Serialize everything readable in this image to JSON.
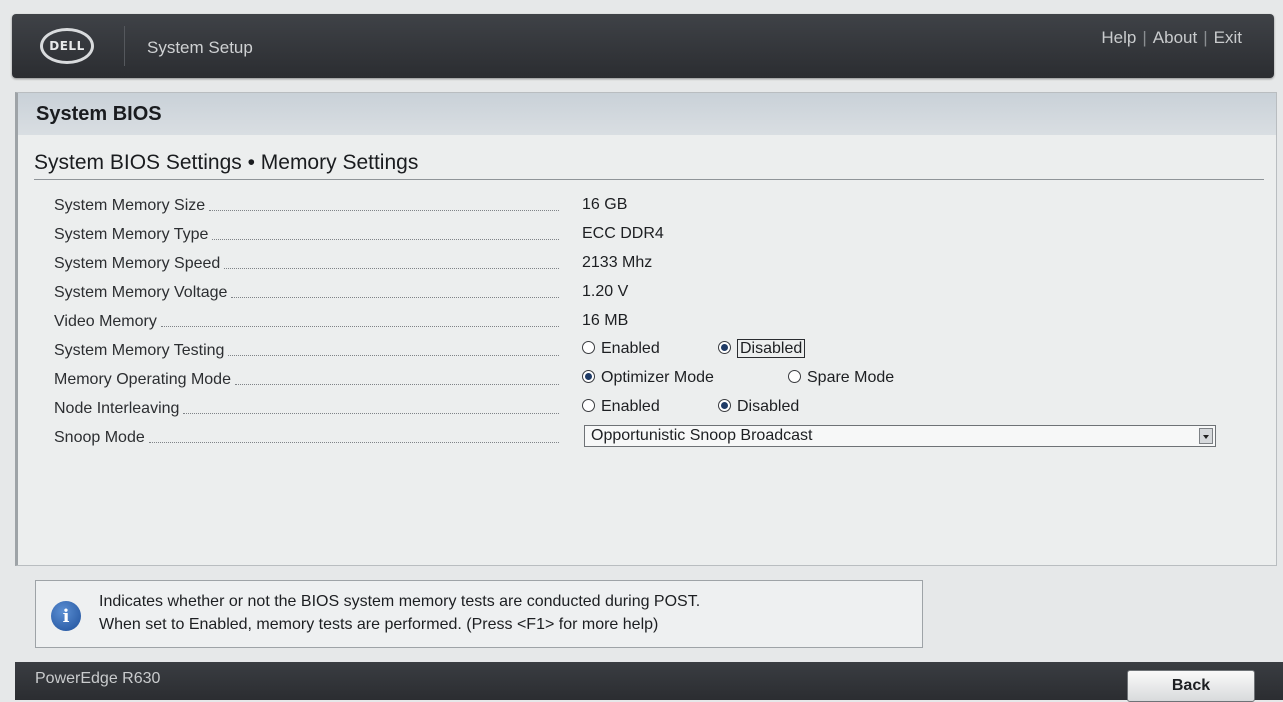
{
  "header": {
    "logo_text": "DELL",
    "title": "System Setup",
    "links": [
      "Help",
      "About",
      "Exit"
    ]
  },
  "panel": {
    "title": "System BIOS",
    "heading": "System BIOS Settings • Memory Settings"
  },
  "settings": [
    {
      "label": "System Memory Size",
      "value": "16 GB"
    },
    {
      "label": "System Memory Type",
      "value": "ECC DDR4"
    },
    {
      "label": "System Memory Speed",
      "value": "2133 Mhz"
    },
    {
      "label": "System Memory Voltage",
      "value": "1.20 V"
    },
    {
      "label": "Video Memory",
      "value": "16 MB"
    },
    {
      "label": "System Memory Testing",
      "options": [
        "Enabled",
        "Disabled"
      ],
      "selected": "Disabled"
    },
    {
      "label": "Memory Operating Mode",
      "options": [
        "Optimizer Mode",
        "Spare Mode"
      ],
      "selected": "Optimizer Mode"
    },
    {
      "label": "Node Interleaving",
      "options": [
        "Enabled",
        "Disabled"
      ],
      "selected": "Disabled"
    },
    {
      "label": "Snoop Mode",
      "dropdown_value": "Opportunistic Snoop Broadcast"
    }
  ],
  "help": {
    "icon": "info-icon",
    "line1": "Indicates whether or not the BIOS system memory tests are conducted during POST.",
    "line2": "When set to Enabled, memory tests are performed. (Press <F1> for more help)"
  },
  "footer": {
    "model": "PowerEdge R630",
    "back_label": "Back"
  },
  "colors": {
    "header_bg": "#2b2d31",
    "panel_band": "#c9d1d8",
    "radio_fill": "#1f3b66",
    "info_icon": "#1e4f9a"
  }
}
